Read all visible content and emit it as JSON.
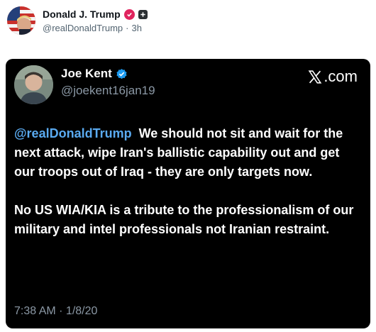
{
  "post": {
    "author_name": "Donald J. Trump",
    "author_handle": "@realDonaldTrump",
    "separator": "·",
    "time_ago": "3h"
  },
  "embed": {
    "name": "Joe Kent",
    "handle": "@joekent16jan19",
    "brand_text": ".com",
    "mention": "@realDonaldTrump",
    "paragraph1_body": "We should not sit and wait for the next attack, wipe Iran's ballistic capability out and get our troops out of Iraq - they are only targets now.",
    "paragraph2": "No US WIA/KIA is a tribute to the professionalism of our military and intel professionals not Iranian restraint.",
    "timestamp": "7:38 AM · 1/8/20"
  },
  "colors": {
    "verified_blue": "#1d9bf0",
    "mention_blue": "#5aaaf0",
    "badge_red": "#e0245e"
  },
  "icons": [
    "flag-avatar",
    "verified-badge-red",
    "plus-badge",
    "verified-badge-blue",
    "x-logo-icon"
  ]
}
